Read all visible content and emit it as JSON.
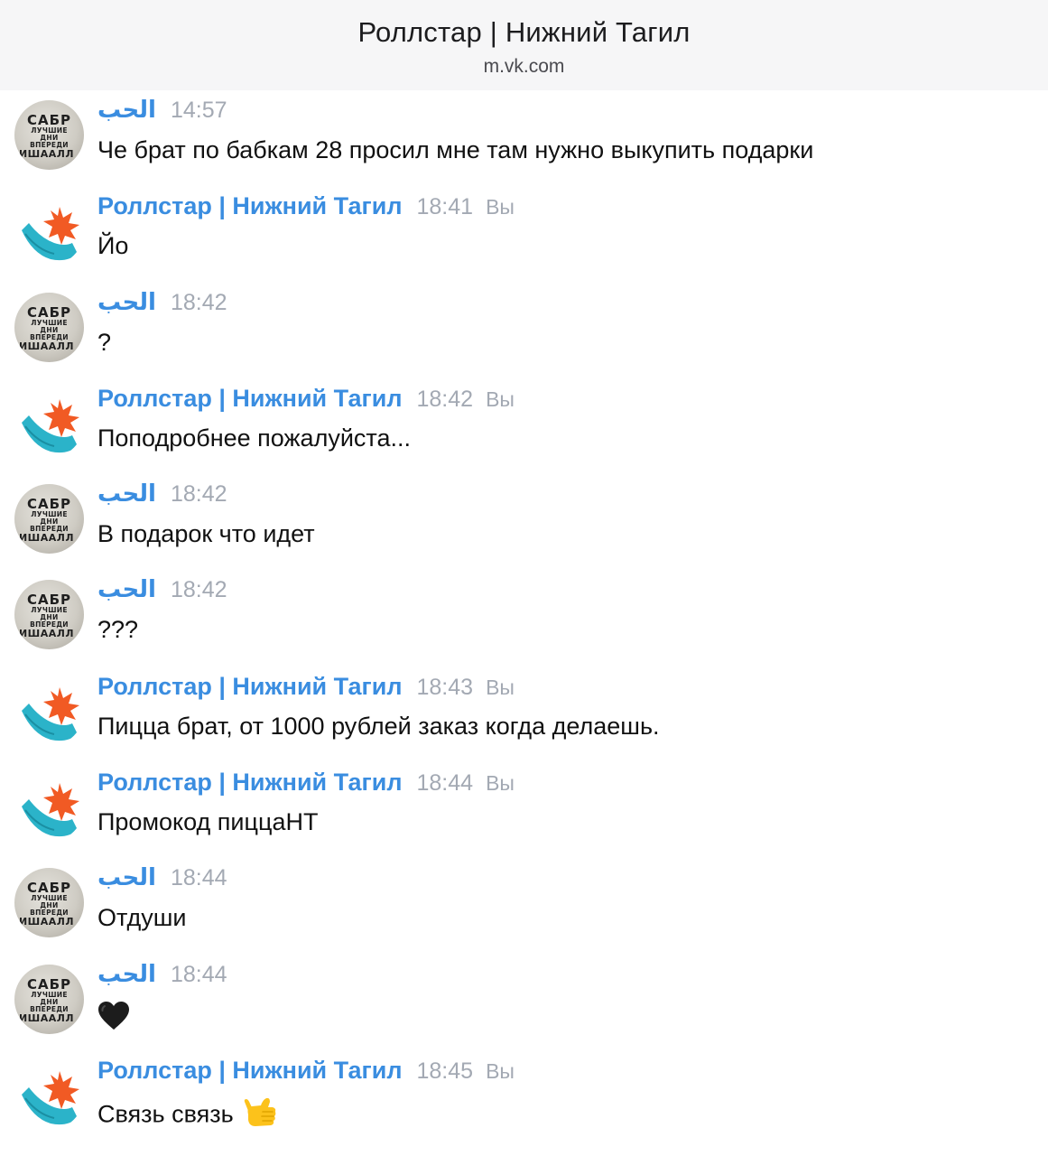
{
  "header": {
    "title": "Роллстар | Нижний Тагил",
    "subtitle": "m.vk.com"
  },
  "avatars": {
    "sabr_top": "САБР",
    "sabr_line1": "ЛУЧШИЕ",
    "sabr_line2": "ДНИ",
    "sabr_line3": "ВПЕРЕДИ",
    "sabr_bottom": "ИШААЛЛ"
  },
  "colors": {
    "sender_name": "#3a8de0",
    "timestamp": "#a3a9b3",
    "logo_teal": "#2bb3c9",
    "logo_orange": "#f15a24"
  },
  "messages": [
    {
      "sender": "الحب",
      "time": "14:57",
      "you": "",
      "text": "Че брат по бабкам 28 просил мне там нужно выкупить подарки",
      "avatar": "sabr"
    },
    {
      "sender": "Роллстар | Нижний Тагил",
      "time": "18:41",
      "you": "Вы",
      "text": "Йо",
      "avatar": "logo"
    },
    {
      "sender": "الحب",
      "time": "18:42",
      "you": "",
      "text": "?",
      "avatar": "sabr"
    },
    {
      "sender": "Роллстар | Нижний Тагил",
      "time": "18:42",
      "you": "Вы",
      "text": "Поподробнее пожалуйста...",
      "avatar": "logo"
    },
    {
      "sender": "الحب",
      "time": "18:42",
      "you": "",
      "text": "В подарок что идет",
      "avatar": "sabr"
    },
    {
      "sender": "الحب",
      "time": "18:42",
      "you": "",
      "text": "???",
      "avatar": "sabr"
    },
    {
      "sender": "Роллстар | Нижний Тагил",
      "time": "18:43",
      "you": "Вы",
      "text": "Пицца брат, от 1000 рублей заказ когда делаешь.",
      "avatar": "logo"
    },
    {
      "sender": "Роллстар | Нижний Тагил",
      "time": "18:44",
      "you": "Вы",
      "text": "Промокод пиццаНТ",
      "avatar": "logo"
    },
    {
      "sender": "الحب",
      "time": "18:44",
      "you": "",
      "text": "Отдуши",
      "avatar": "sabr"
    },
    {
      "sender": "الحب",
      "time": "18:44",
      "you": "",
      "text": "",
      "emoji": "black-heart",
      "avatar": "sabr"
    },
    {
      "sender": "Роллстар | Нижний Тагил",
      "time": "18:45",
      "you": "Вы",
      "text": "Связь связь",
      "emoji": "call-me-hand",
      "avatar": "logo"
    }
  ]
}
